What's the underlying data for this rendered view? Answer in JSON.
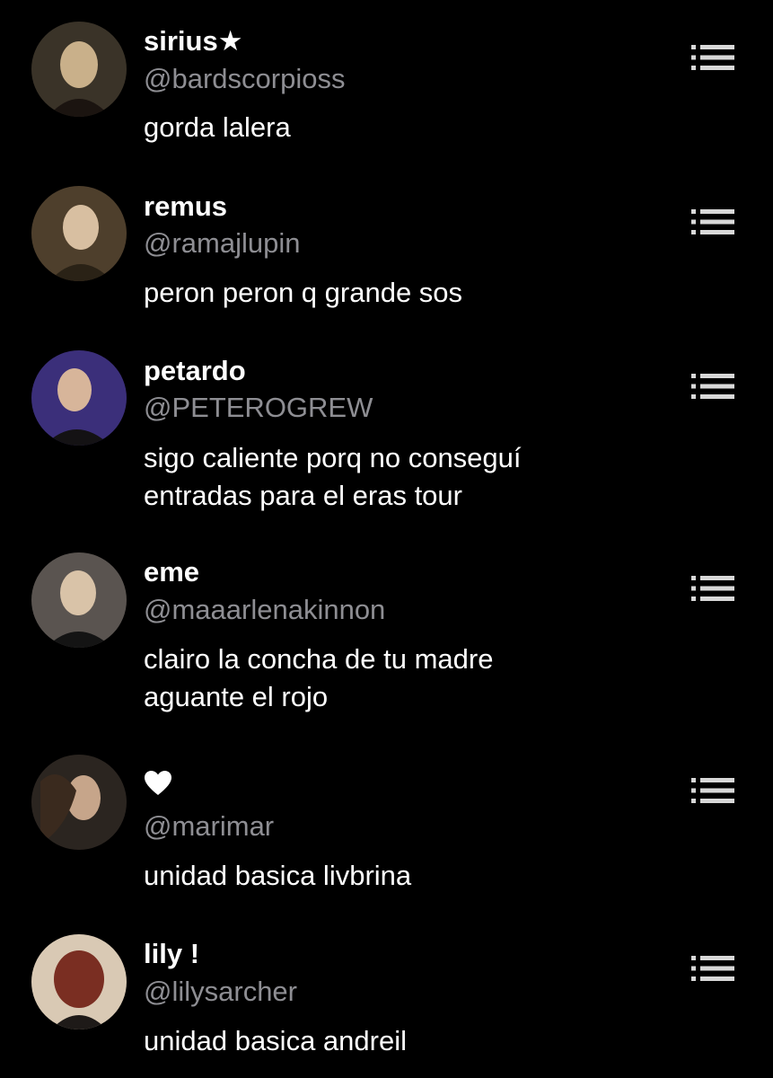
{
  "accounts": [
    {
      "display_name": "sirius★",
      "handle": "@bardscorpioss",
      "text": [
        "gorda lalera"
      ],
      "avatar_colors": [
        "#3a3328",
        "#c9b08a",
        "#1b1410"
      ]
    },
    {
      "display_name": "remus",
      "handle": "@ramajlupin",
      "text": [
        "peron peron q grande sos"
      ],
      "avatar_colors": [
        "#4e3f2c",
        "#d8bfa1",
        "#2a2216"
      ]
    },
    {
      "display_name": "petardo",
      "handle": "@PETEROGREW",
      "text": [
        "sigo caliente porq no conseguí",
        "entradas para el eras tour"
      ],
      "avatar_colors": [
        "#3b2f7a",
        "#d7b59a",
        "#141214"
      ]
    },
    {
      "display_name": "eme",
      "handle": "@maaarlenakinnon",
      "text": [
        "clairo la concha de tu madre",
        "aguante el rojo"
      ],
      "avatar_colors": [
        "#5a5450",
        "#d9c3a8",
        "#141414"
      ]
    },
    {
      "display_name": "♥",
      "handle": "@marimar",
      "text": [
        "unidad basica livbrina"
      ],
      "avatar_colors": [
        "#2b2520",
        "#c6a58a",
        "#3a2a1e"
      ]
    },
    {
      "display_name": "lily !",
      "handle": "@lilysarcher",
      "text": [
        "unidad basica andreil"
      ],
      "avatar_colors": [
        "#d9c9b4",
        "#7a2e22",
        "#1e1a18"
      ]
    }
  ],
  "icons": {
    "menu": "list-menu-icon",
    "avatar": "profile-photo"
  },
  "colors": {
    "background": "#000000",
    "name": "#ffffff",
    "handle": "#8e8e93",
    "body": "#ffffff",
    "icon": "#d8d8d8"
  }
}
